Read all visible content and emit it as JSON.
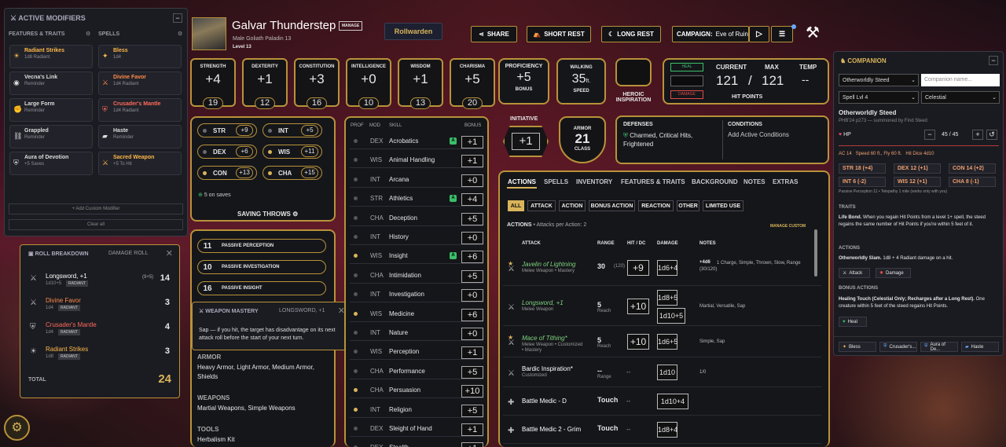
{
  "modifiers": {
    "title": "ACTIVE MODIFIERS",
    "col1": "FEATURES & TRAITS",
    "col2": "SPELLS",
    "items": [
      {
        "name": "Radiant Strikes",
        "sub": "1d8 Radiant",
        "icon": "☀",
        "color": "#ffb84a"
      },
      {
        "name": "Bless",
        "sub": "1d4",
        "icon": "✦",
        "color": "#ffb84a"
      },
      {
        "name": "Vecna's Link",
        "sub": "Reminder",
        "icon": "◉",
        "color": "#ddd"
      },
      {
        "name": "Divine Favor",
        "sub": "1d4 Radiant",
        "icon": "⚔",
        "color": "#ff8a4a"
      },
      {
        "name": "Large Form",
        "sub": "Reminder",
        "icon": "✊",
        "color": "#ddd"
      },
      {
        "name": "Crusader's Mantle",
        "sub": "1d4 Radiant",
        "icon": "⛨",
        "color": "#ff6a5a"
      },
      {
        "name": "Grappled",
        "sub": "Reminder",
        "icon": "⛓",
        "color": "#ddd"
      },
      {
        "name": "Haste",
        "sub": "Reminder",
        "icon": "▰",
        "color": "#ddd"
      },
      {
        "name": "Aura of Devotion",
        "sub": "+5 Saves",
        "icon": "⛨",
        "color": "#ddd"
      },
      {
        "name": "Sacred Weapon",
        "sub": "+5 To Hit",
        "icon": "⚔",
        "color": "#ffb84a"
      }
    ],
    "add": "+ Add Custom Modifier",
    "clear": "Clear all"
  },
  "roll": {
    "title": "ROLL BREAKDOWN",
    "subtitle": "DAMAGE ROLL",
    "rows": [
      {
        "name": "Longsword, +1",
        "detail": "1d10+5",
        "tag": "RADIANT",
        "calc": "(9+5)",
        "value": "14",
        "color": "#fff"
      },
      {
        "name": "Divine Favor",
        "detail": "1d4",
        "tag": "RADIANT",
        "calc": "",
        "value": "3",
        "color": "#ff8a4a"
      },
      {
        "name": "Crusader's Mantle",
        "detail": "1d4",
        "tag": "RADIANT",
        "calc": "",
        "value": "4",
        "color": "#ff6a5a"
      },
      {
        "name": "Radiant Strikes",
        "detail": "1d8",
        "tag": "RADIANT",
        "calc": "",
        "value": "3",
        "color": "#ffb84a"
      }
    ],
    "total_label": "TOTAL",
    "total": "24"
  },
  "mastery": {
    "title": "WEAPON MASTERY",
    "subtitle": "LONGSWORD, +1",
    "text": "Sap — if you hit, the target has disadvantage on its next attack roll before the start of your next turn."
  },
  "character": {
    "name": "Galvar Thunderstep",
    "manage": "MANAGE",
    "desc": "Male  Goliath  Paladin 13",
    "level": "Level 13",
    "campaign_btn": "Rollwarden"
  },
  "top": {
    "share": "SHARE",
    "short_rest": "SHORT REST",
    "long_rest": "LONG REST",
    "campaign_label": "CAMPAIGN:",
    "campaign": "Eve of Ruin"
  },
  "abilities": [
    {
      "label": "STRENGTH",
      "mod": "+4",
      "score": "19"
    },
    {
      "label": "DEXTERITY",
      "mod": "+1",
      "score": "12"
    },
    {
      "label": "CONSTITUTION",
      "mod": "+3",
      "score": "16"
    },
    {
      "label": "INTELLIGENCE",
      "mod": "+0",
      "score": "10"
    },
    {
      "label": "WISDOM",
      "mod": "+1",
      "score": "13"
    },
    {
      "label": "CHARISMA",
      "mod": "+5",
      "score": "20"
    }
  ],
  "prof": {
    "label": "PROFICIENCY",
    "value": "+5",
    "sub": "BONUS"
  },
  "speed": {
    "label": "WALKING",
    "value": "35",
    "unit": "ft.",
    "sub": "SPEED"
  },
  "heroic": {
    "label": "HEROIC INSPIRATION"
  },
  "hp": {
    "heal": "HEAL",
    "damage": "DAMAGE",
    "current_label": "CURRENT",
    "max_label": "MAX",
    "temp_label": "TEMP",
    "current": "121",
    "sep": "/",
    "max": "121",
    "temp": "--",
    "label": "HIT POINTS"
  },
  "saves": [
    {
      "ab": "STR",
      "v": "+9",
      "p": false
    },
    {
      "ab": "INT",
      "v": "+5",
      "p": false
    },
    {
      "ab": "DEX",
      "v": "+6",
      "p": false
    },
    {
      "ab": "WIS",
      "v": "+11",
      "p": true
    },
    {
      "ab": "CON",
      "v": "+13",
      "p": true
    },
    {
      "ab": "CHA",
      "v": "+15",
      "p": true
    }
  ],
  "saves_note": "5 on saves",
  "saves_label": "SAVING THROWS",
  "passives": [
    {
      "v": "11",
      "l": "PASSIVE PERCEPTION"
    },
    {
      "v": "10",
      "l": "PASSIVE INVESTIGATION"
    },
    {
      "v": "16",
      "l": "PASSIVE INSIGHT"
    }
  ],
  "profs": {
    "armor_label": "ARMOR",
    "armor": "Heavy Armor, Light Armor, Medium Armor, Shields",
    "weapons_label": "WEAPONS",
    "weapons": "Martial Weapons, Simple Weapons",
    "tools_label": "TOOLS",
    "tools": "Herbalism Kit"
  },
  "skills_head": {
    "prof": "PROF",
    "mod": "MOD",
    "skill": "SKILL",
    "bonus": "BONUS"
  },
  "skills": [
    {
      "m": "DEX",
      "n": "Acrobatics",
      "b": "+1",
      "p": false,
      "a": true
    },
    {
      "m": "WIS",
      "n": "Animal Handling",
      "b": "+1",
      "p": false,
      "a": false
    },
    {
      "m": "INT",
      "n": "Arcana",
      "b": "+0",
      "p": false,
      "a": false
    },
    {
      "m": "STR",
      "n": "Athletics",
      "b": "+4",
      "p": false,
      "a": true
    },
    {
      "m": "CHA",
      "n": "Deception",
      "b": "+5",
      "p": false,
      "a": false
    },
    {
      "m": "INT",
      "n": "History",
      "b": "+0",
      "p": false,
      "a": false
    },
    {
      "m": "WIS",
      "n": "Insight",
      "b": "+6",
      "p": true,
      "a": true
    },
    {
      "m": "CHA",
      "n": "Intimidation",
      "b": "+5",
      "p": false,
      "a": false
    },
    {
      "m": "INT",
      "n": "Investigation",
      "b": "+0",
      "p": false,
      "a": false
    },
    {
      "m": "WIS",
      "n": "Medicine",
      "b": "+6",
      "p": true,
      "a": false
    },
    {
      "m": "INT",
      "n": "Nature",
      "b": "+0",
      "p": false,
      "a": false
    },
    {
      "m": "WIS",
      "n": "Perception",
      "b": "+1",
      "p": false,
      "a": false
    },
    {
      "m": "CHA",
      "n": "Performance",
      "b": "+5",
      "p": false,
      "a": false
    },
    {
      "m": "CHA",
      "n": "Persuasion",
      "b": "+10",
      "p": true,
      "a": false
    },
    {
      "m": "INT",
      "n": "Religion",
      "b": "+5",
      "p": true,
      "a": false
    },
    {
      "m": "DEX",
      "n": "Sleight of Hand",
      "b": "+1",
      "p": false,
      "a": false
    },
    {
      "m": "DEX",
      "n": "Stealth",
      "b": "+1",
      "p": false,
      "a": false
    }
  ],
  "initiative": {
    "label": "INITIATIVE",
    "value": "+1"
  },
  "armor": {
    "label": "ARMOR",
    "value": "21",
    "sub": "CLASS"
  },
  "defenses": {
    "label": "DEFENSES",
    "value": "Charmed, Critical Hits, Frightened"
  },
  "conditions": {
    "label": "CONDITIONS",
    "value": "Add Active Conditions"
  },
  "tabs": [
    "ACTIONS",
    "SPELLS",
    "INVENTORY",
    "FEATURES & TRAITS",
    "BACKGROUND",
    "NOTES",
    "EXTRAS"
  ],
  "filters": [
    "ALL",
    "ATTACK",
    "ACTION",
    "BONUS ACTION",
    "REACTION",
    "OTHER",
    "LIMITED USE"
  ],
  "actions_head": {
    "title": "ACTIONS",
    "note": "• Attacks per Action: 2",
    "manage": "MANAGE CUSTOM",
    "attack": "ATTACK",
    "range": "RANGE",
    "hit": "HIT / DC",
    "damage": "DAMAGE",
    "notes": "NOTES"
  },
  "actions": [
    {
      "name": "Javelin of Lightning",
      "sub": "Melee Weapon • Mastery",
      "range": "30",
      "range2": "(120)",
      "hit": "+9",
      "dmg": "1d6+4",
      "dmg2": "",
      "extra": "+4d6",
      "notes": "1 Charge, Simple, Thrown, Slow, Range (30/120)",
      "color": "#7ed37e"
    },
    {
      "name": "Longsword, +1",
      "sub": "Melee Weapon",
      "range": "5",
      "range2": "Reach",
      "hit": "+10",
      "dmg": "1d8+5",
      "dmg2": "1d10+5",
      "extra": "",
      "notes": "Martial, Versatile, Sap",
      "color": "#7ed37e"
    },
    {
      "name": "Mace of Tithing*",
      "sub": "Melee Weapon • Customized • Mastery",
      "range": "5",
      "range2": "Reach",
      "hit": "+10",
      "dmg": "1d6+5",
      "dmg2": "",
      "extra": "",
      "notes": "Simple, Sap",
      "color": "#7ed37e"
    },
    {
      "name": "Bardic Inspiration*",
      "sub": "Customized",
      "range": "--",
      "range2": "Range",
      "hit": "--",
      "dmg": "1d10",
      "dmg2": "",
      "extra": "",
      "notes": "1/0",
      "color": "#fff"
    },
    {
      "name": "Battle Medic - D",
      "sub": "",
      "range": "Touch",
      "range2": "",
      "hit": "--",
      "dmg": "1d10+4",
      "dmg2": "",
      "extra": "",
      "notes": "",
      "color": "#fff"
    },
    {
      "name": "Battle Medic 2 - Grim",
      "sub": "",
      "range": "Touch",
      "range2": "",
      "hit": "--",
      "dmg": "1d8+4",
      "dmg2": "",
      "extra": "",
      "notes": "",
      "color": "#fff"
    }
  ],
  "companion": {
    "title": "COMPANION",
    "type": "Otherworldly Steed",
    "name_ph": "Companion name...",
    "spell": "Spell Lvl 4",
    "kind": "Celestial",
    "name": "Otherworldly Steed",
    "source": "PHB'24 p273 — summoned by Find Steed",
    "hp_label": "HP",
    "hp": "45 / 45",
    "ac": "AC 14",
    "speed": "Speed 60 ft., Fly 60 ft.",
    "hd": "Hit Dice 4d10",
    "stats": [
      "STR 18 (+4)",
      "DEX 12 (+1)",
      "CON 14 (+2)",
      "INT 6 (-2)",
      "WIS 12 (+1)",
      "CHA 8 (-1)"
    ],
    "senses": "Passive Perception 11 • Telepathy 1 mile (works only with you)",
    "traits_label": "TRAITS",
    "trait_name": "Life Bond.",
    "trait": "When you regain Hit Points from a level 1+ spell, the steed regains the same number of Hit Points if you're within 5 feet of it.",
    "actions_label": "ACTIONS",
    "action_name": "Otherworldly Slam.",
    "action": "1d8 + 4 Radiant damage on a hit.",
    "attack_btn": "Attack",
    "damage_btn": "Damage",
    "bonus_label": "BONUS ACTIONS",
    "bonus_name": "Healing Touch (Celestial Only; Recharges after a Long Rest).",
    "bonus": "One creature within 5 feet of the steed regains Hit Points.",
    "heal_btn": "Heal",
    "chips": [
      "Bless",
      "Crusader's...",
      "Aura of De...",
      "Haste"
    ]
  }
}
